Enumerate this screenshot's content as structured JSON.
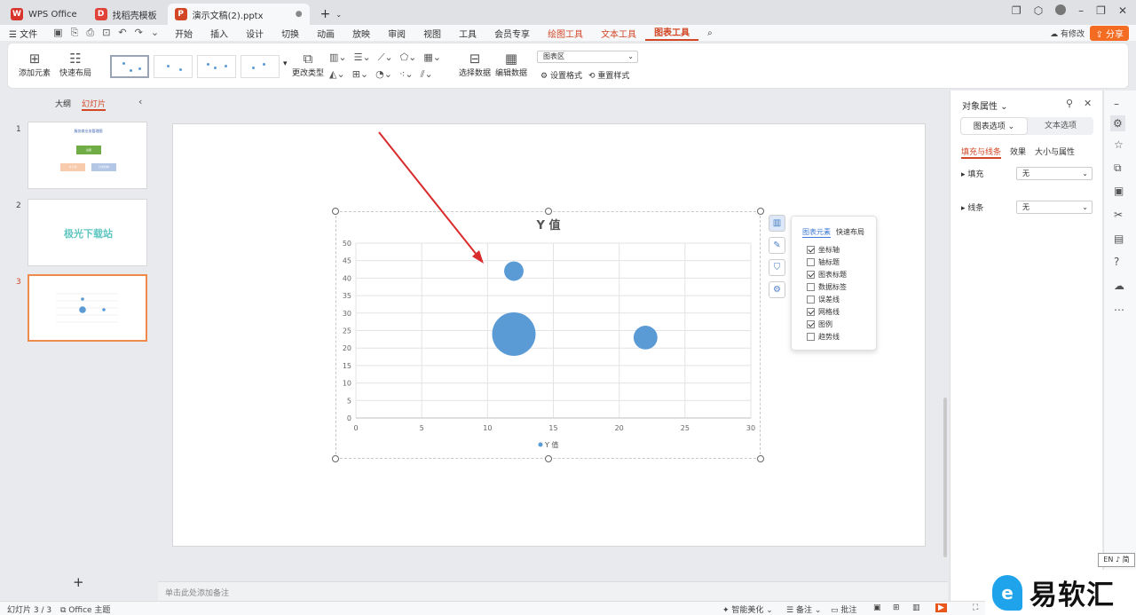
{
  "tabs": [
    {
      "label": "WPS Office",
      "color": "#d9342b",
      "glyph": "W"
    },
    {
      "label": "找稻壳模板",
      "color": "#e0423a",
      "glyph": "D"
    },
    {
      "label": "演示文稿(2).pptx",
      "color": "#d24726",
      "glyph": "P"
    }
  ],
  "menu": {
    "file": "文件",
    "items": [
      "开始",
      "插入",
      "设计",
      "切换",
      "动画",
      "放映",
      "审阅",
      "视图",
      "工具",
      "会员专享"
    ],
    "context": [
      "绘图工具",
      "文本工具"
    ],
    "active": "图表工具",
    "modify": "有修改",
    "share": "分享"
  },
  "ribbon": {
    "add_element": "添加元素",
    "quick_layout": "快速布局",
    "change_type": "更改类型",
    "select_data": "选择数据",
    "edit_data": "编辑数据",
    "area_select": "图表区",
    "set_format": "设置格式",
    "reset_style": "重置样式"
  },
  "left_panel": {
    "tab_outline": "大纲",
    "tab_slides": "幻灯片",
    "slides": [
      {
        "num": "1",
        "title": "服务商业务管理图",
        "box1": "总部",
        "box2": "分公司",
        "box3": "分支机构"
      },
      {
        "num": "2",
        "text": "极光下载站"
      },
      {
        "num": "3"
      }
    ]
  },
  "chart_data": {
    "type": "bubble",
    "title": "Y 值",
    "legend": "Y 值",
    "legend_position": "bottom",
    "xlim": [
      0,
      30
    ],
    "ylim": [
      0,
      50
    ],
    "xticks": [
      "0",
      "5",
      "10",
      "15",
      "20",
      "25",
      "30"
    ],
    "yticks": [
      "0",
      "5",
      "10",
      "15",
      "20",
      "25",
      "30",
      "35",
      "40",
      "45",
      "50"
    ],
    "grid": true,
    "color": "#5b9bd5",
    "points": [
      {
        "x": 12,
        "y": 42,
        "size": 1
      },
      {
        "x": 12,
        "y": 24,
        "size": 5
      },
      {
        "x": 22,
        "y": 23,
        "size": 1.5
      }
    ]
  },
  "chart_elements_popup": {
    "tab_elements": "图表元素",
    "tab_layout": "快速布局",
    "options": [
      {
        "label": "坐标轴",
        "checked": true
      },
      {
        "label": "轴标题",
        "checked": false
      },
      {
        "label": "图表标题",
        "checked": true
      },
      {
        "label": "数据标签",
        "checked": false
      },
      {
        "label": "误差线",
        "checked": false
      },
      {
        "label": "网格线",
        "checked": true
      },
      {
        "label": "图例",
        "checked": true
      },
      {
        "label": "趋势线",
        "checked": false
      }
    ]
  },
  "notes_placeholder": "单击此处添加备注",
  "right_panel": {
    "title": "对象属性",
    "seg_chart": "图表选项",
    "seg_text": "文本选项",
    "sub_fill": "填充与线条",
    "sub_effect": "效果",
    "sub_size": "大小与属性",
    "fill_label": "填充",
    "fill_value": "无",
    "line_label": "线条",
    "line_value": "无"
  },
  "status": {
    "slide_count": "幻灯片 3 / 3",
    "theme": "Office 主题",
    "beautify": "智能美化",
    "notes": "备注",
    "comments": "批注"
  },
  "ime": "EN ♪ 简",
  "watermark": "易软汇"
}
